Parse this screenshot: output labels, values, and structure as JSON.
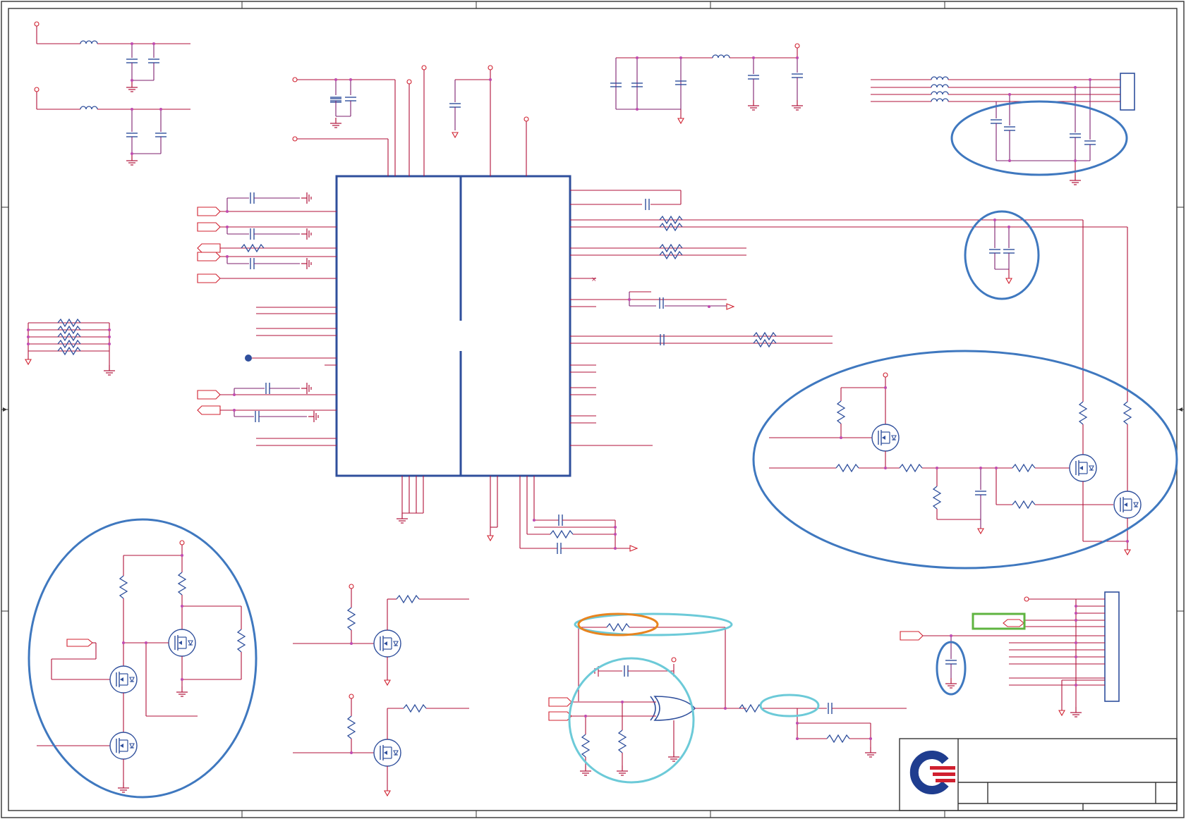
{
  "colors": {
    "wire": "#b0123a",
    "net": "#7d1f6e",
    "component": "#2f4f9c",
    "highlight_blue": "#3f78bf",
    "highlight_cyan": "#6ccad8",
    "highlight_orange": "#e8841f",
    "highlight_green": "#5fb440",
    "logo_blue": "#1f3d8f",
    "logo_red": "#d0202f"
  },
  "logo": {
    "icon": "company-logo-icon"
  },
  "title_block": {
    "title": "",
    "sheet": "",
    "rev": ""
  }
}
